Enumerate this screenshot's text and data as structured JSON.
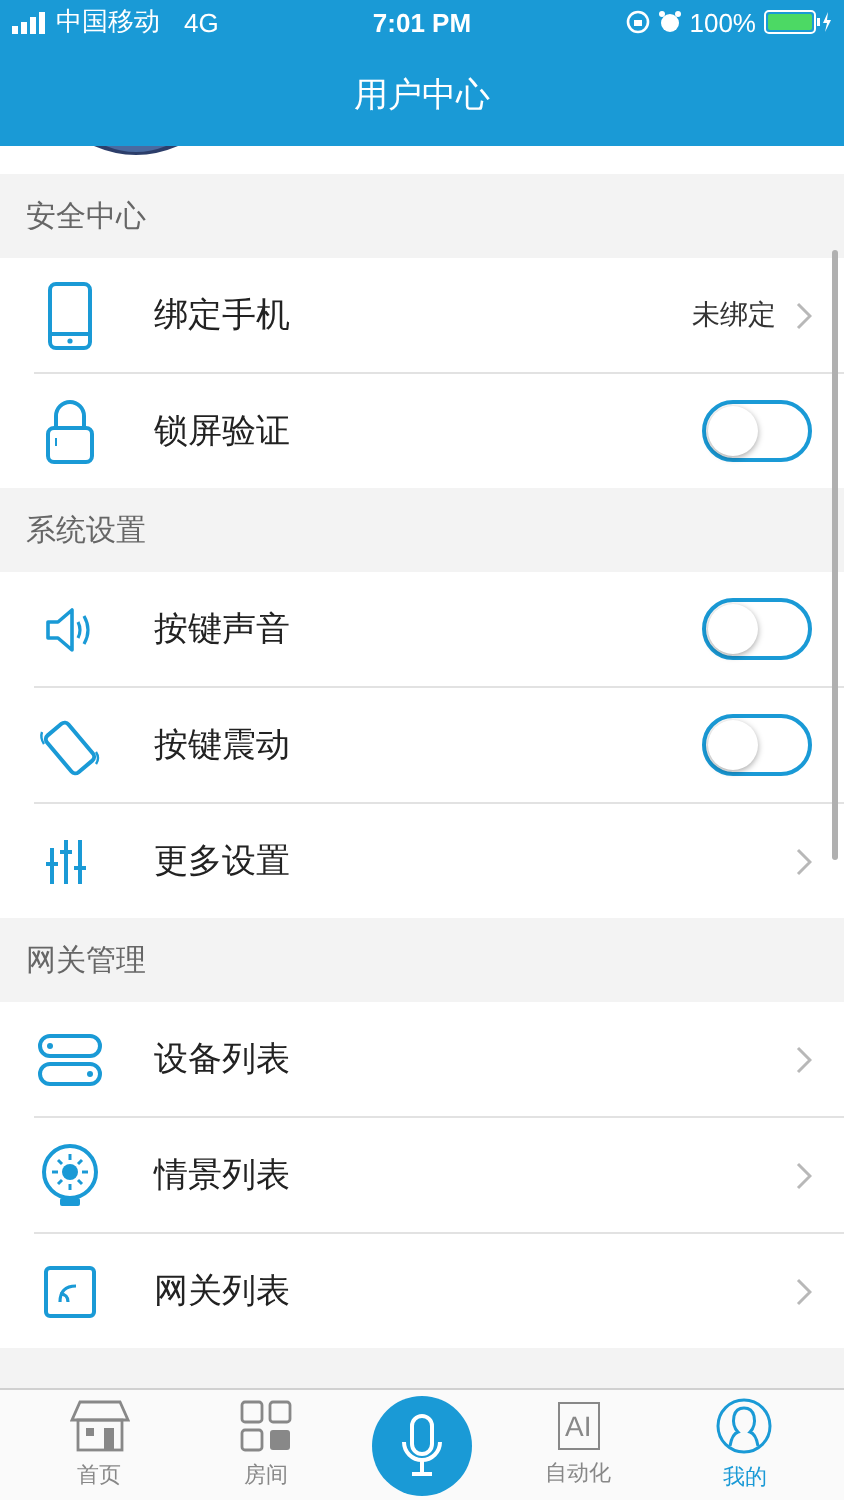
{
  "status_bar": {
    "carrier": "中国移动",
    "network": "4G",
    "time": "7:01 PM",
    "battery": "100%"
  },
  "nav": {
    "title": "用户中心"
  },
  "sections": [
    {
      "title": "安全中心",
      "rows": [
        {
          "kind": "link",
          "label": "绑定手机",
          "value": "未绑定"
        },
        {
          "kind": "toggle",
          "label": "锁屏验证",
          "on": false
        }
      ]
    },
    {
      "title": "系统设置",
      "rows": [
        {
          "kind": "toggle",
          "label": "按键声音",
          "on": false
        },
        {
          "kind": "toggle",
          "label": "按键震动",
          "on": false
        },
        {
          "kind": "link",
          "label": "更多设置"
        }
      ]
    },
    {
      "title": "网关管理",
      "rows": [
        {
          "kind": "link",
          "label": "设备列表"
        },
        {
          "kind": "link",
          "label": "情景列表"
        },
        {
          "kind": "link",
          "label": "网关列表"
        }
      ]
    }
  ],
  "tabs": [
    {
      "kind": "home",
      "label": "首页",
      "selected": false
    },
    {
      "kind": "rooms",
      "label": "房间",
      "selected": false
    },
    {
      "kind": "mic"
    },
    {
      "kind": "ai",
      "icon_text": "AI",
      "label": "自动化",
      "selected": false
    },
    {
      "kind": "me",
      "label": "我的",
      "selected": true
    }
  ]
}
